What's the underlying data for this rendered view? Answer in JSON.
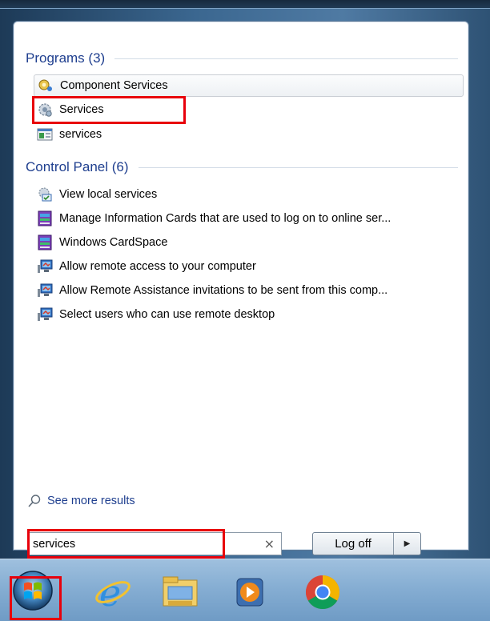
{
  "programs": {
    "header": "Programs (3)",
    "items": [
      {
        "label": "Component Services",
        "icon": "component-services-icon"
      },
      {
        "label": "Services",
        "icon": "services-gear-icon"
      },
      {
        "label": "services",
        "icon": "msc-file-icon"
      }
    ]
  },
  "control_panel": {
    "header": "Control Panel (6)",
    "items": [
      {
        "label": "View local services",
        "icon": "local-services-icon"
      },
      {
        "label": "Manage Information Cards that are used to log on to online ser...",
        "icon": "cardspace-icon"
      },
      {
        "label": "Windows CardSpace",
        "icon": "cardspace-icon"
      },
      {
        "label": "Allow remote access to your computer",
        "icon": "remote-access-icon"
      },
      {
        "label": "Allow Remote Assistance invitations to be sent from this comp...",
        "icon": "remote-access-icon"
      },
      {
        "label": "Select users who can use remote desktop",
        "icon": "remote-access-icon"
      }
    ]
  },
  "see_more": "See more results",
  "search": {
    "value": "services",
    "clear_glyph": "×"
  },
  "logoff": {
    "label": "Log off",
    "arrow": "▶"
  },
  "taskbar": {
    "icons": [
      "start-orb-icon",
      "internet-explorer-icon",
      "file-explorer-icon",
      "media-player-icon",
      "chrome-icon"
    ]
  },
  "colors": {
    "highlight_border": "#e8000b",
    "header_text": "#1f3f8f"
  }
}
